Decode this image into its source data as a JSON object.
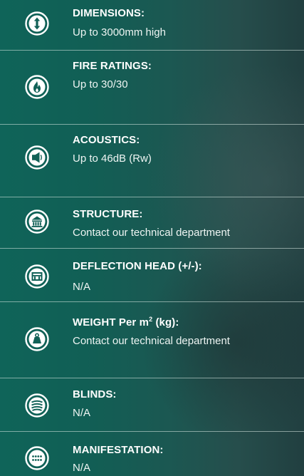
{
  "specs": [
    {
      "id": "dimensions",
      "icon": "dimensions-icon",
      "title": "DIMENSIONS:",
      "value": "Up to 3000mm high"
    },
    {
      "id": "fire-ratings",
      "icon": "fire-icon",
      "title": "FIRE RATINGS:",
      "value": "Up to 30/30"
    },
    {
      "id": "acoustics",
      "icon": "speaker-icon",
      "title": "ACOUSTICS:",
      "value": "Up to 46dB (Rw)"
    },
    {
      "id": "structure",
      "icon": "structure-icon",
      "title": "STRUCTURE:",
      "value": "Contact our technical department"
    },
    {
      "id": "deflection-head",
      "icon": "deflection-head-icon",
      "title": "DEFLECTION HEAD (+/-):",
      "value": "N/A"
    },
    {
      "id": "weight",
      "icon": "weight-icon",
      "title_prefix": "WEIGHT Per m",
      "title_sup": "2",
      "title_suffix": " (kg):",
      "value": "Contact our technical department"
    },
    {
      "id": "blinds",
      "icon": "blinds-icon",
      "title": "BLINDS:",
      "value": "N/A"
    },
    {
      "id": "manifestation",
      "icon": "manifestation-icon",
      "title": "MANIFESTATION:",
      "value": "N/A"
    }
  ],
  "colors": {
    "text": "#ffffff",
    "background_left": "#0f6459",
    "background_right": "#213f40"
  }
}
